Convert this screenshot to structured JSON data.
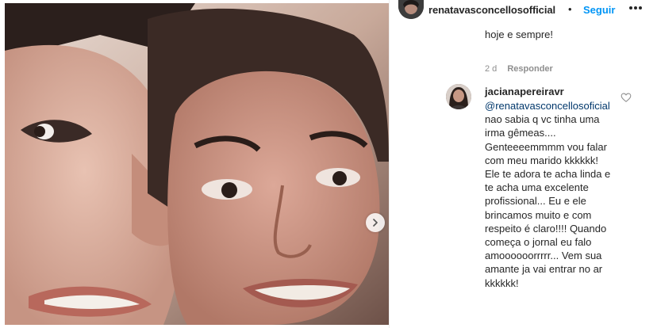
{
  "media": {
    "image_alt": "photo"
  },
  "post_header": {
    "username": "renatavasconcellosofficial",
    "separator": "•",
    "follow_label": "Seguir"
  },
  "previous_comment": {
    "text_tail": "hoje e sempre!",
    "time": "2 d",
    "reply_label": "Responder"
  },
  "comment": {
    "username": "jacianapereiravr",
    "mention": "@renatavasconcellosoficial",
    "text": " nao sabia q vc tinha uma irma gêmeas.... Genteeeemmmm vou falar com meu marido kkkkkk! Ele te adora te acha linda e te acha uma excelente profissional... Eu e ele brincamos muito e com respeito é claro!!!! Quando começa o jornal eu falo amoooooorrrrr... Vem sua amante ja vai entrar no ar kkkkkk!"
  },
  "icons": {
    "more": "more-horizontal-icon",
    "like": "heart-outline-icon",
    "carousel": "chevron-right-icon"
  },
  "colors": {
    "follow": "#0095f6",
    "mention": "#00376b",
    "meta": "#8e8e8e"
  }
}
